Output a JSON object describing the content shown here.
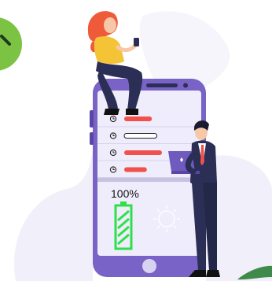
{
  "battery": {
    "level_text": "100%",
    "level_fraction": 1.0
  },
  "phone": {
    "settings_rows": [
      {
        "icon": "clock-icon",
        "bar_fill": 0.55,
        "bar_style": "solid"
      },
      {
        "icon": "timer-icon",
        "bar_fill": 0.65,
        "bar_style": "outline"
      },
      {
        "icon": "stopwatch-icon",
        "bar_fill": 0.75,
        "bar_style": "solid"
      },
      {
        "icon": "alarm-icon",
        "bar_fill": 0.45,
        "bar_style": "solid"
      }
    ]
  },
  "colors": {
    "phone_body": "#7a63c6",
    "phone_screen": "#efedfb",
    "bar_red": "#f2504b",
    "battery_green": "#2fe04b",
    "badge_green": "#7cc243",
    "woman_hair": "#ef5a3a",
    "woman_shirt": "#f5c436",
    "suit_navy": "#2b2f55",
    "blob_lilac": "#f1effa"
  }
}
